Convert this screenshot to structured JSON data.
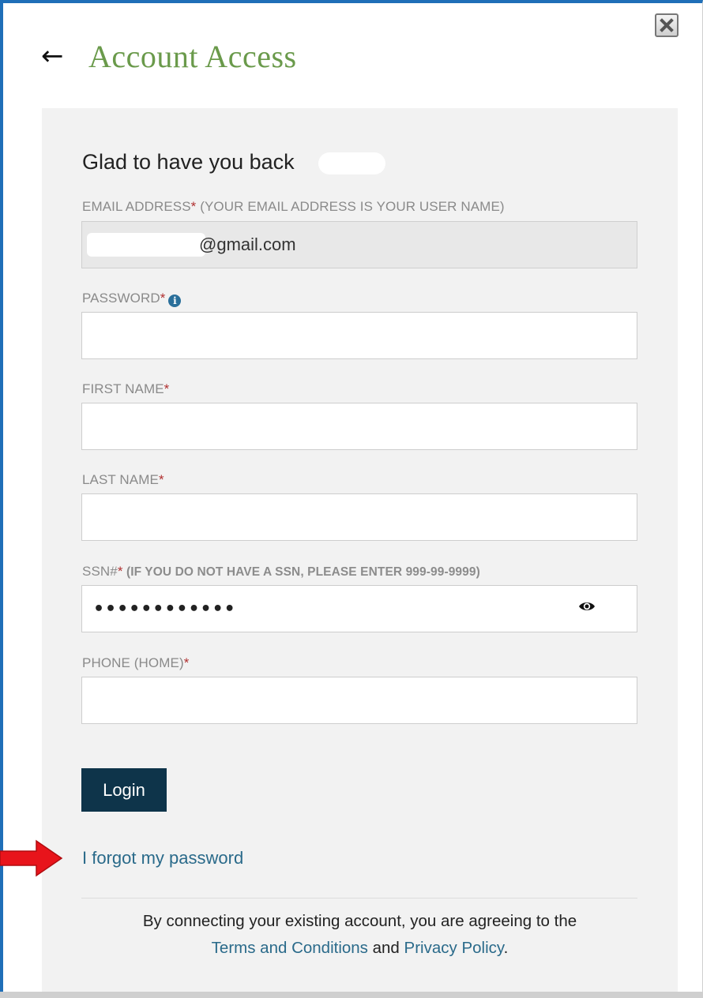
{
  "modal": {
    "title": "Account Access",
    "back_icon": "←",
    "close_icon": "close-icon"
  },
  "form": {
    "greeting": "Glad to have you back",
    "email": {
      "label": "EMAIL ADDRESS",
      "required_mark": "*",
      "note": " (YOUR EMAIL ADDRESS IS YOUR USER NAME)",
      "value": "@gmail.com"
    },
    "password": {
      "label": "PASSWORD",
      "required_mark": "*",
      "info_icon": "i"
    },
    "first_name": {
      "label": "FIRST NAME",
      "required_mark": "*"
    },
    "last_name": {
      "label": "LAST NAME",
      "required_mark": "*"
    },
    "ssn": {
      "label": "SSN#",
      "required_mark": "*",
      "note": " (IF YOU DO NOT HAVE A SSN, PLEASE ENTER 999-99-9999)",
      "masked_value": "••••••••••••"
    },
    "phone": {
      "label": "PHONE (HOME)",
      "required_mark": "*"
    },
    "login_label": "Login",
    "forgot_password": "I forgot my password"
  },
  "footer": {
    "text_before": "By connecting your existing account, you are agreeing to the",
    "terms_link": "Terms and Conditions",
    "and_text": " and ",
    "privacy_link": "Privacy Policy",
    "period": "."
  },
  "colors": {
    "title_green": "#6a9a4b",
    "button_navy": "#0e344a",
    "link_blue": "#2a6a8a",
    "required_red": "#b03030",
    "arrow_red": "#e8141b"
  }
}
